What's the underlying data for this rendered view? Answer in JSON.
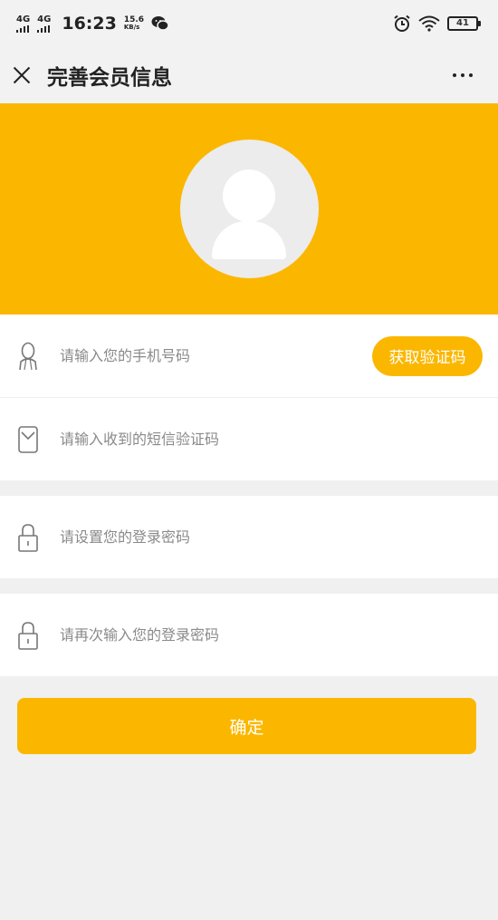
{
  "status_bar": {
    "signal1": "4G",
    "signal2": "4G",
    "time": "16:23",
    "speed_value": "15.6",
    "speed_unit": "KB/s",
    "battery": "41"
  },
  "header": {
    "title": "完善会员信息"
  },
  "form": {
    "phone_placeholder": "请输入您的手机号码",
    "get_code_label": "获取验证码",
    "sms_placeholder": "请输入收到的短信验证码",
    "password_placeholder": "请设置您的登录密码",
    "password_confirm_placeholder": "请再次输入您的登录密码"
  },
  "confirm_label": "确定",
  "colors": {
    "accent": "#fbb700",
    "background": "#f0f0f0"
  }
}
